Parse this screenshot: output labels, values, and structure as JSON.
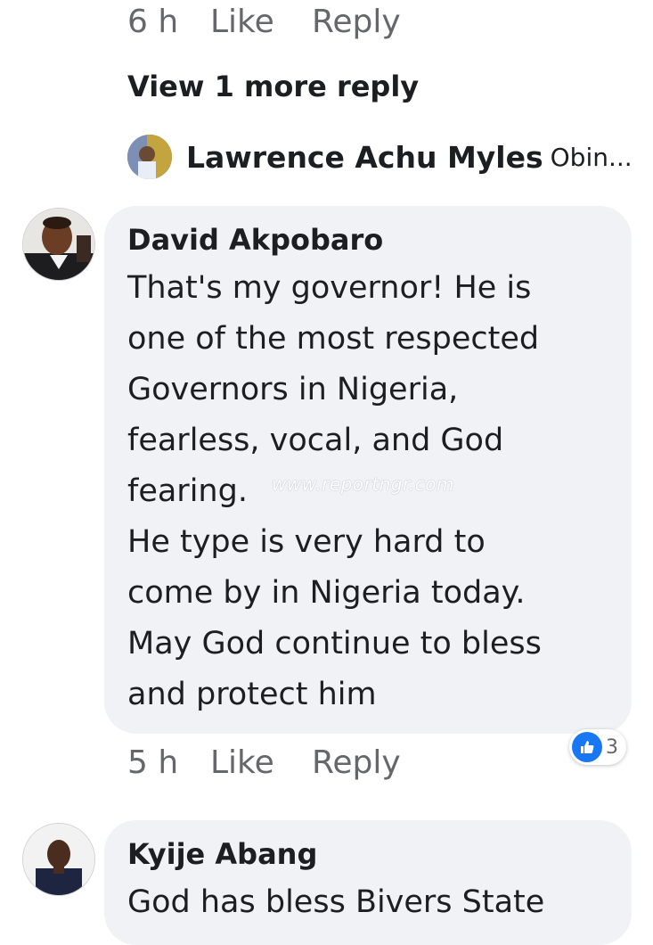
{
  "previous_comment": {
    "time": "6 h",
    "like_label": "Like",
    "reply_label": "Reply",
    "view_more": "View 1 more reply",
    "reply_preview": {
      "name": "Lawrence Achu Myles",
      "snippet": "Obin..."
    }
  },
  "comments": [
    {
      "author": "David Akpobaro",
      "text": "That's my governor! He is\none of the most respected\nGovernors in Nigeria,\nfearless, vocal, and God\nfearing.\nHe type is very hard to\ncome by in Nigeria today.\nMay God continue to bless\nand protect him",
      "time": "5 h",
      "like_label": "Like",
      "reply_label": "Reply",
      "reactions": {
        "icon": "thumbs-up-icon",
        "count": "3",
        "color": "#1877f2"
      }
    },
    {
      "author": "Kyije Abang",
      "text": "God has bless Bivers State"
    }
  ],
  "watermark": "www.reportngr.com",
  "colors": {
    "bubble": "#f0f2f5",
    "meta_text": "#65676b",
    "primary_text": "#1c1e21",
    "like_blue": "#1877f2"
  }
}
